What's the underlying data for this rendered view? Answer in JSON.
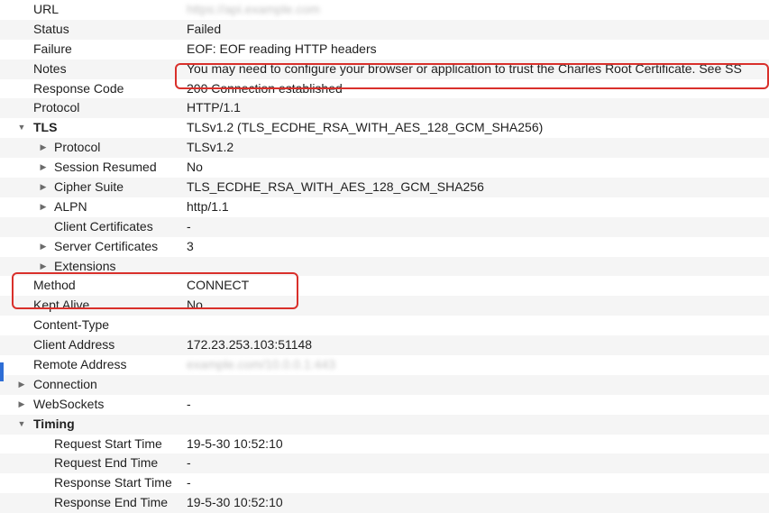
{
  "colors": {
    "annotation": "#d9302b",
    "selection_marker": "#2e6ed6",
    "stripe": "#f5f5f5"
  },
  "rows": [
    {
      "name": "URL",
      "value": "https://api.example.com",
      "level": 0,
      "blurred": true
    },
    {
      "name": "Status",
      "value": "Failed",
      "level": 0
    },
    {
      "name": "Failure",
      "value": "EOF: EOF reading HTTP headers",
      "level": 0
    },
    {
      "name": "Notes",
      "value": "You may need to configure your browser or application to trust the Charles Root Certificate. See SS",
      "level": 0
    },
    {
      "name": "Response Code",
      "value": "200 Connection established",
      "level": 0
    },
    {
      "name": "Protocol",
      "value": "HTTP/1.1",
      "level": 0
    },
    {
      "name": "TLS",
      "value": "TLSv1.2 (TLS_ECDHE_RSA_WITH_AES_128_GCM_SHA256)",
      "level": 0,
      "expander": "expanded",
      "bold": true
    },
    {
      "name": "Protocol",
      "value": "TLSv1.2",
      "level": 1,
      "expander": "collapsed"
    },
    {
      "name": "Session Resumed",
      "value": "No",
      "level": 1,
      "expander": "collapsed"
    },
    {
      "name": "Cipher Suite",
      "value": "TLS_ECDHE_RSA_WITH_AES_128_GCM_SHA256",
      "level": 1,
      "expander": "collapsed"
    },
    {
      "name": "ALPN",
      "value": "http/1.1",
      "level": 1,
      "expander": "collapsed"
    },
    {
      "name": "Client Certificates",
      "value": "-",
      "level": 1
    },
    {
      "name": "Server Certificates",
      "value": "3",
      "level": 1,
      "expander": "collapsed"
    },
    {
      "name": "Extensions",
      "value": "",
      "level": 1,
      "expander": "collapsed"
    },
    {
      "name": "Method",
      "value": "CONNECT",
      "level": 0
    },
    {
      "name": "Kept Alive",
      "value": "No",
      "level": 0
    },
    {
      "name": "Content-Type",
      "value": "",
      "level": 0
    },
    {
      "name": "Client Address",
      "value": "172.23.253.103:51148",
      "level": 0
    },
    {
      "name": "Remote Address",
      "value": "example.com/10.0.0.1:443",
      "level": 0,
      "blurred": true
    },
    {
      "name": "Connection",
      "value": "",
      "level": 0,
      "expander": "collapsed"
    },
    {
      "name": "WebSockets",
      "value": "-",
      "level": 0,
      "expander": "collapsed"
    },
    {
      "name": "Timing",
      "value": "",
      "level": 0,
      "expander": "expanded",
      "bold": true
    },
    {
      "name": "Request Start Time",
      "value": "19-5-30 10:52:10",
      "level": 1
    },
    {
      "name": "Request End Time",
      "value": "-",
      "level": 1
    },
    {
      "name": "Response Start Time",
      "value": "-",
      "level": 1
    },
    {
      "name": "Response End Time",
      "value": "19-5-30 10:52:10",
      "level": 1
    }
  ]
}
